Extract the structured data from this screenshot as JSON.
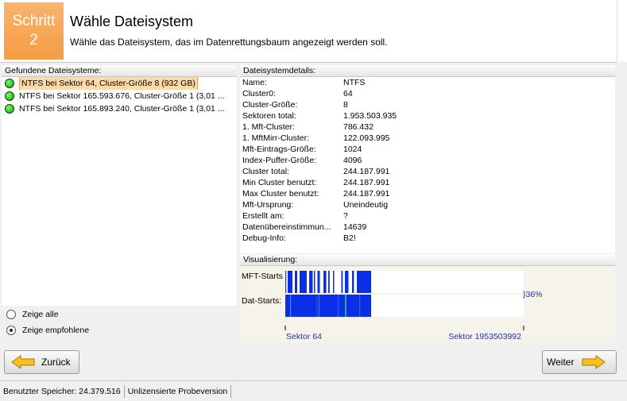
{
  "header": {
    "step_label": "Schritt",
    "step_number": "2",
    "title": "Wähle Dateisystem",
    "subtitle": "Wähle das Dateisystem, das im Datenrettungsbaum angezeigt werden soll."
  },
  "left_panel": {
    "title": "Gefundene Dateisysteme:",
    "items": [
      {
        "label": "NTFS bei Sektor 64, Cluster-Größe 8 (932 GB)",
        "selected": true
      },
      {
        "label": "NTFS bei Sektor 165.593.676, Cluster-Größe 1 (3,01 ...",
        "selected": false
      },
      {
        "label": "NTFS bei Sektor 165.893.240, Cluster-Größe 1 (3,01 ...",
        "selected": false
      }
    ],
    "radio_all": "Zeige alle",
    "radio_recommended": "Zeige empfohlene"
  },
  "details": {
    "title": "Dateisystemdetails:",
    "rows": [
      {
        "label": "Name:",
        "value": "NTFS"
      },
      {
        "label": "Cluster0:",
        "value": "64"
      },
      {
        "label": "Cluster-Größe:",
        "value": "8"
      },
      {
        "label": "Sektoren total:",
        "value": "1.953.503.935"
      },
      {
        "label": "1. Mft-Cluster:",
        "value": "786.432"
      },
      {
        "label": "1. MftMirr-Cluster:",
        "value": "122.093.995"
      },
      {
        "label": "Mft-Eintrags-Größe:",
        "value": "1024"
      },
      {
        "label": "Index-Puffer-Größe:",
        "value": "4096"
      },
      {
        "label": "Cluster total:",
        "value": "244.187.991"
      },
      {
        "label": "Min Cluster benutzt:",
        "value": "244.187.991"
      },
      {
        "label": "Max Cluster benutzt:",
        "value": "244.187.991"
      },
      {
        "label": "Mft-Ursprung:",
        "value": "Uneindeutig"
      },
      {
        "label": "Erstellt am:",
        "value": "?"
      },
      {
        "label": "Datenübereinstimmun...",
        "value": "14639"
      },
      {
        "label": "Debug-Info:",
        "value": "B2!"
      }
    ]
  },
  "visual": {
    "title": "Visualisierung:",
    "mft_label": "MFT-Starts",
    "dat_label": "Dat-Starts:",
    "percent": "}36%",
    "sector_start": "Sektor 64",
    "sector_end": "Sektor 1953503992",
    "fill_fraction": 0.36,
    "bar_color": "#0a2fe6"
  },
  "buttons": {
    "back": "Zurück",
    "next": "Weiter"
  },
  "status": {
    "memory": "Benutzter Speicher: 24.379.516",
    "license": "Unlizensierte Probeversion"
  }
}
